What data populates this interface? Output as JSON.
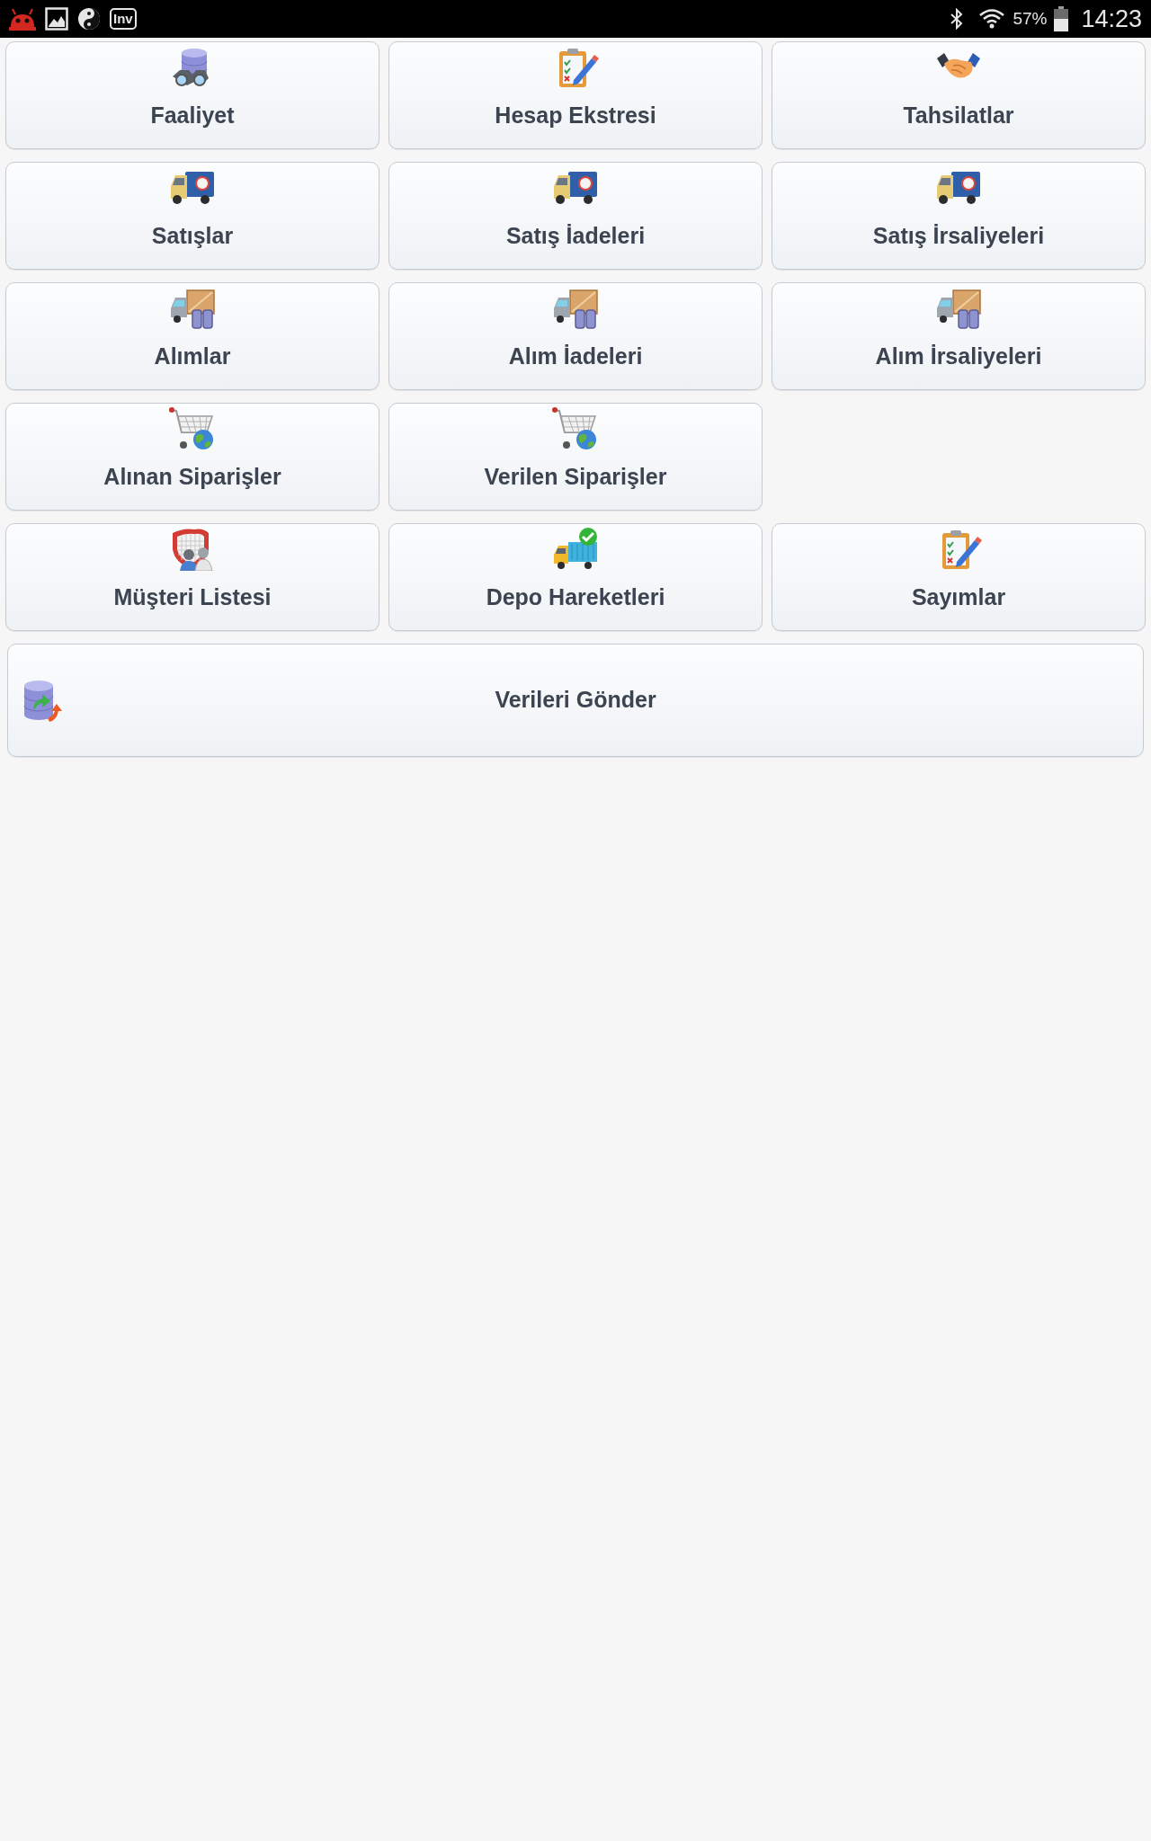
{
  "status_bar": {
    "app_label": "Inv",
    "battery": "57%",
    "time": "14:23"
  },
  "menu_rows": [
    [
      "Faaliyet",
      "Hesap Ekstresi",
      "Tahsilatlar"
    ],
    [
      "Satışlar",
      "Satış İadeleri",
      "Satış İrsaliyeleri"
    ],
    [
      "Alımlar",
      "Alım İadeleri",
      "Alım İrsaliyeleri"
    ],
    [
      "Alınan Siparişler",
      "Verilen Siparişler"
    ],
    [
      "Müşteri Listesi",
      "Depo Hareketleri",
      "Sayımlar"
    ]
  ],
  "send_button": {
    "label": "Verileri Gönder"
  }
}
